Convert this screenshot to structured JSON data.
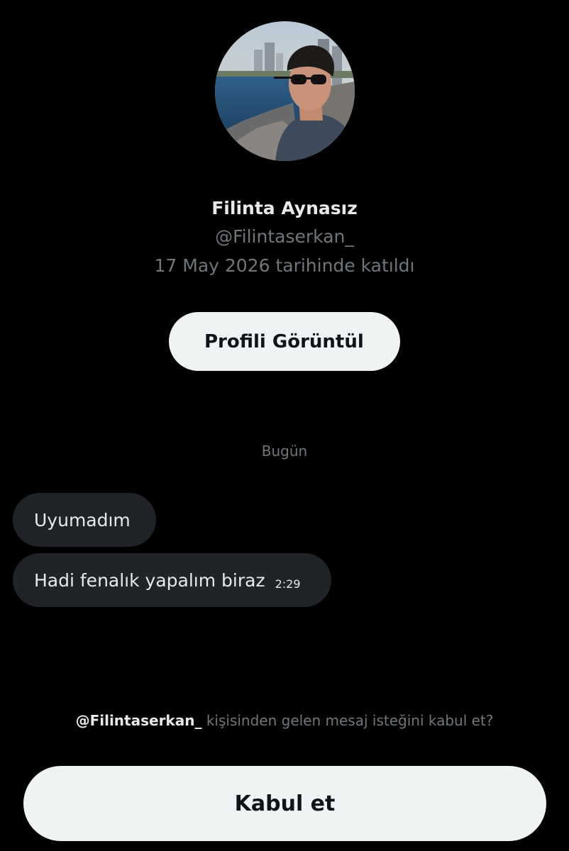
{
  "profile": {
    "name": "Filinta Aynasız",
    "handle": "@Filintaserkan_",
    "joined": "17 May 2026 tarihinde katıldı",
    "view_profile_label": "Profili Görüntüle"
  },
  "conversation": {
    "date_separator": "Bugün",
    "messages": [
      {
        "text": "Uyumadım",
        "time": ""
      },
      {
        "text": "Hadi fenalık yapalım biraz",
        "time": "2:29"
      }
    ]
  },
  "request": {
    "handle": "@Filintaserkan_",
    "prompt_rest": " kişisinden gelen mesaj isteğini kabul et?",
    "accept_label": "Kabul et"
  },
  "colors": {
    "background": "#000000",
    "primary_text": "#e7e9ea",
    "secondary_text": "#71767b",
    "bubble": "#202327",
    "button_bg": "#eff3f4",
    "button_text": "#0f1419"
  }
}
